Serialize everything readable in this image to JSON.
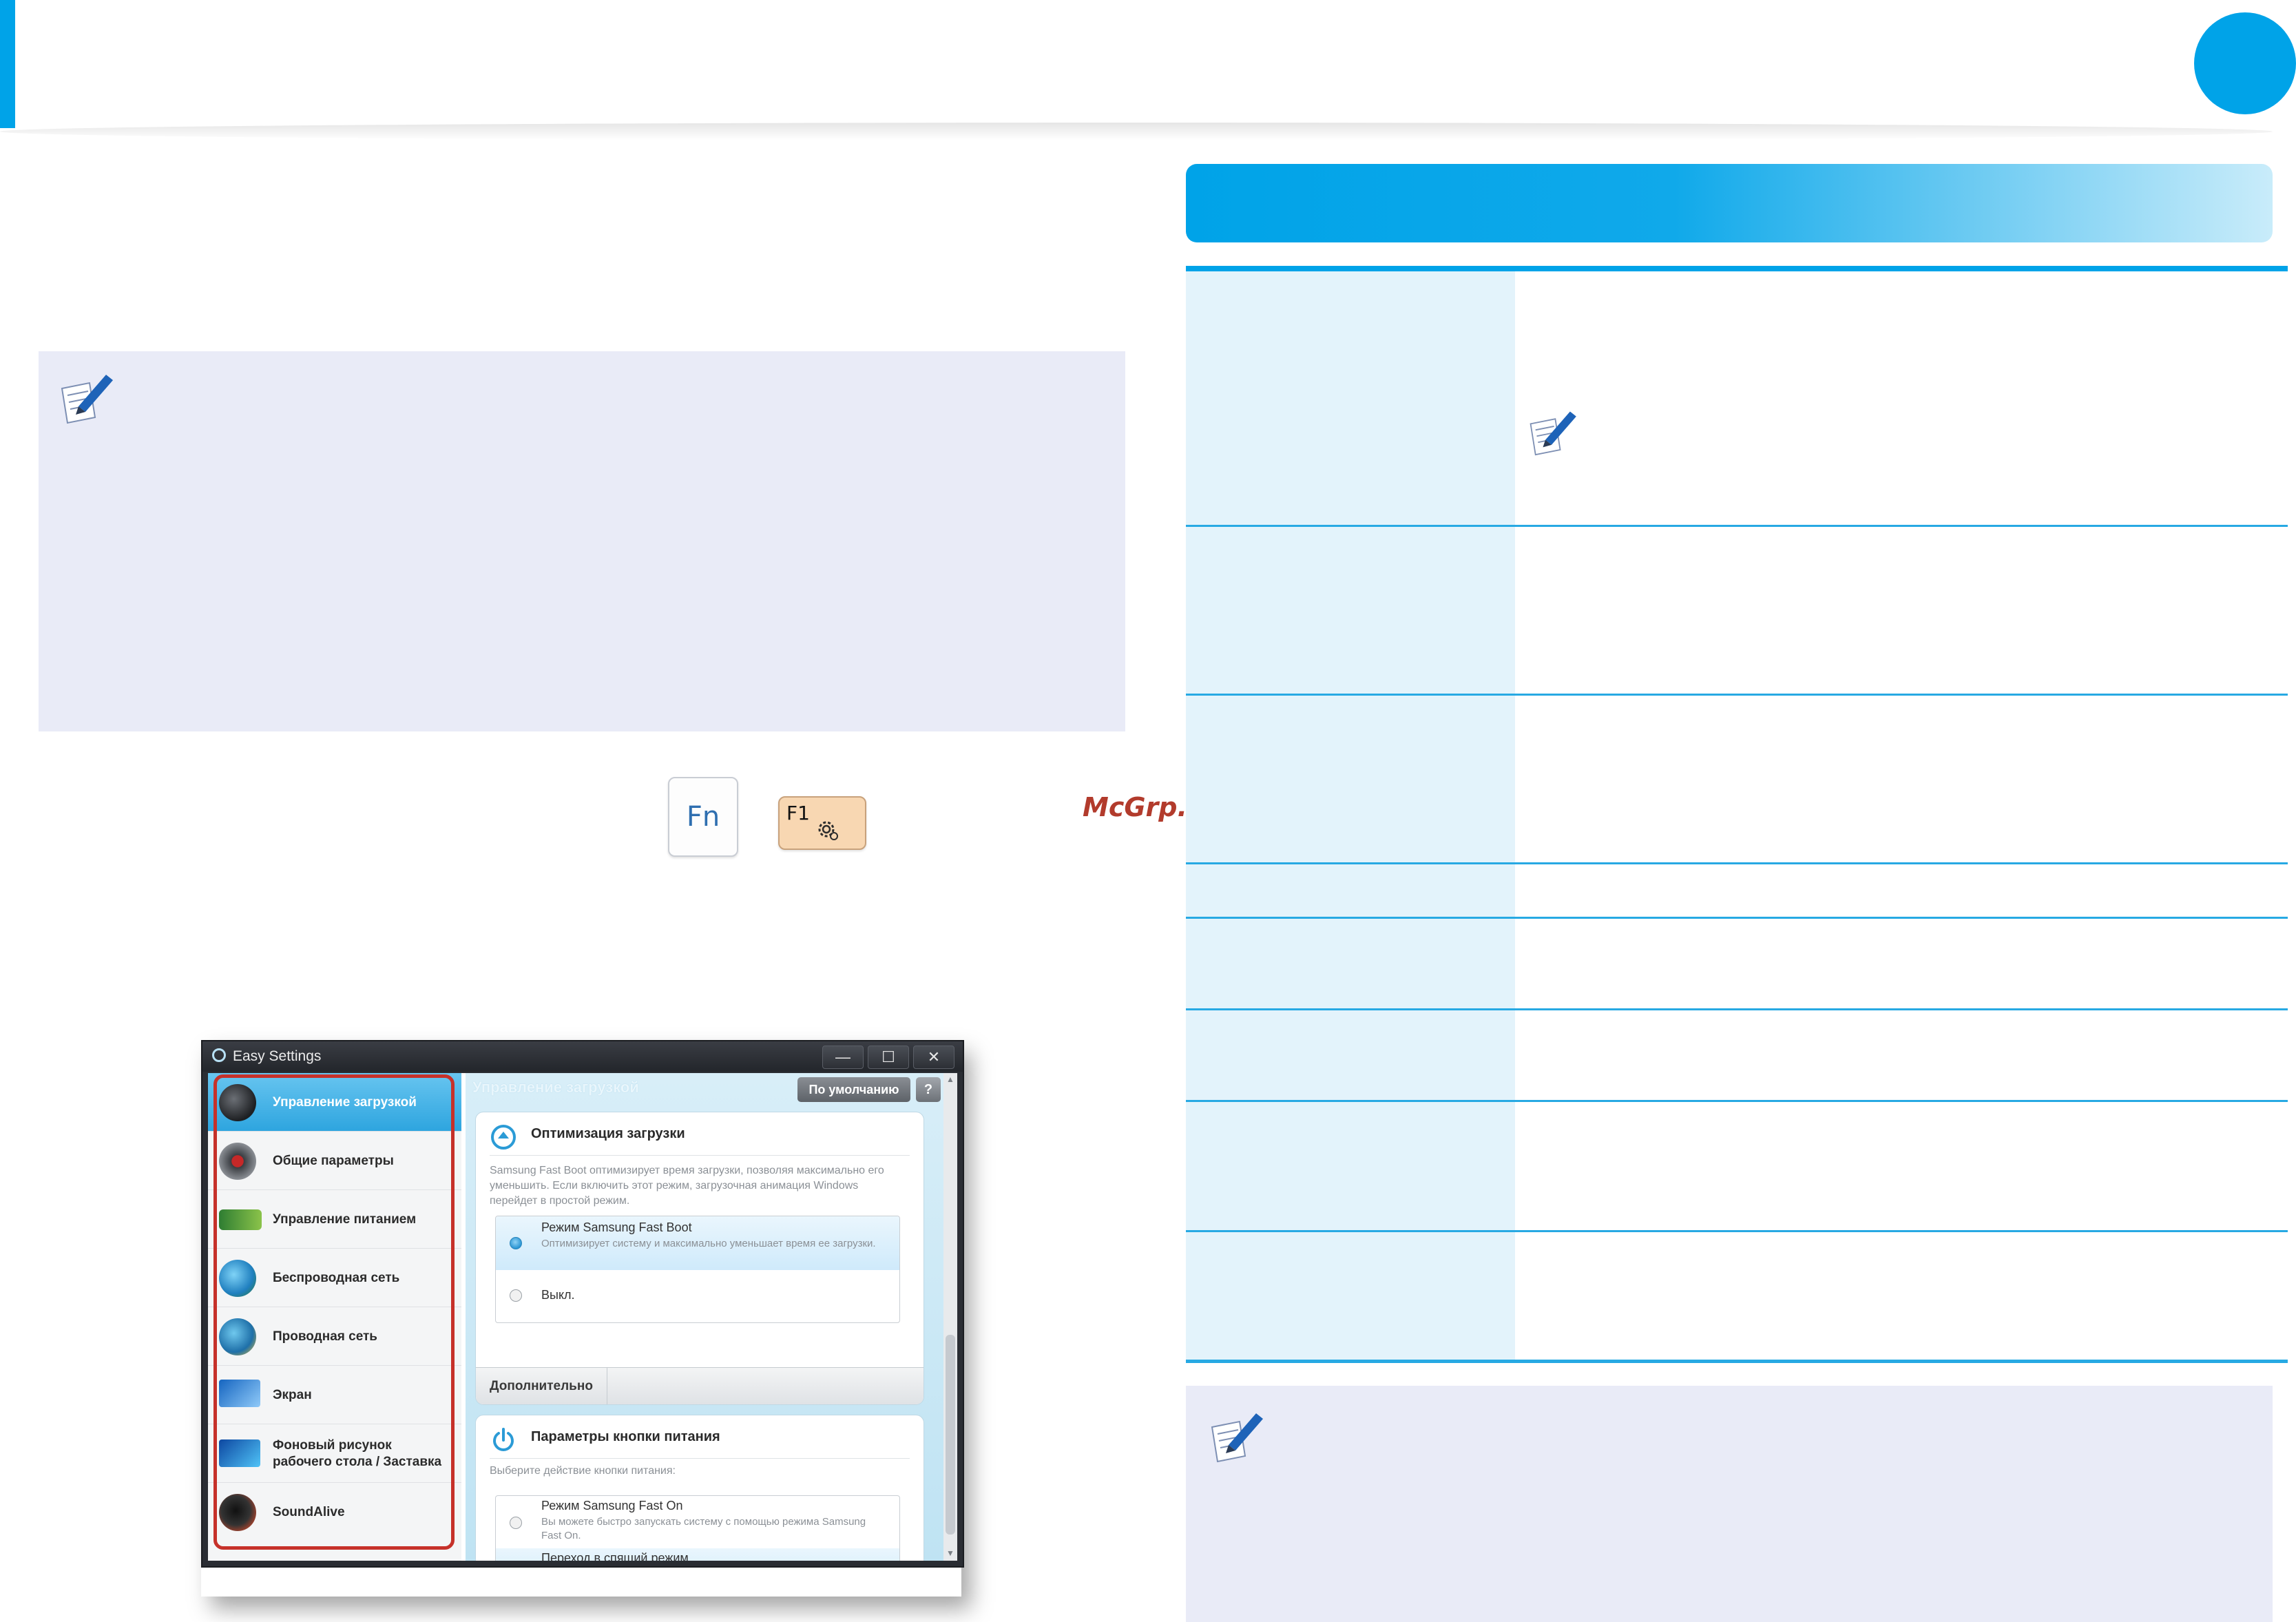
{
  "keys": {
    "fn_label": "Fn",
    "f1_label": "F1"
  },
  "watermark": "McGrp.Ru",
  "app": {
    "window_title": "Easy Settings",
    "window_buttons": {
      "minimize": "—",
      "maximize": "☐",
      "close": "✕"
    },
    "sidebar": {
      "items": [
        {
          "label": "Управление загрузкой",
          "icon": "boot-manager-icon"
        },
        {
          "label": "Общие параметры",
          "icon": "general-settings-icon"
        },
        {
          "label": "Управление питанием",
          "icon": "battery-icon"
        },
        {
          "label": "Беспроводная сеть",
          "icon": "wireless-icon"
        },
        {
          "label": "Проводная сеть",
          "icon": "wired-network-icon"
        },
        {
          "label": "Экран",
          "icon": "display-icon"
        },
        {
          "label": "Фоновый рисунок рабочего стола / Заставка",
          "icon": "wallpaper-icon"
        },
        {
          "label": "SoundAlive",
          "icon": "sound-icon"
        }
      ]
    },
    "main": {
      "title": "Управление загрузкой",
      "defaults_button": "По умолчанию",
      "help_button": "?",
      "boot_panel": {
        "title": "Оптимизация загрузки",
        "description": "Samsung Fast Boot оптимизирует время загрузки, позволяя максимально его уменьшить. Если включить этот режим, загрузочная анимация Windows перейдет в простой режим.",
        "options": [
          {
            "title": "Режим Samsung Fast Boot",
            "description": "Оптимизирует систему и максимально уменьшает время ее загрузки.",
            "selected": true
          },
          {
            "title": "Выкл.",
            "description": "",
            "selected": false
          }
        ],
        "extra_button": "Дополнительно"
      },
      "power_panel": {
        "title": "Параметры кнопки питания",
        "description": "Выберите действие кнопки питания:",
        "options": [
          {
            "title": "Режим Samsung Fast On",
            "description": "Вы можете быстро запускать систему с помощью режима Samsung Fast On.",
            "selected": false
          },
          {
            "title": "Переход в спящий режим",
            "description": "",
            "selected": true
          }
        ]
      }
    }
  },
  "colors": {
    "accent": "#00a3e8",
    "note_bg": "#e9ebf7",
    "highlight": "#c6312a",
    "table_left_bg": "#e3f3fb"
  }
}
